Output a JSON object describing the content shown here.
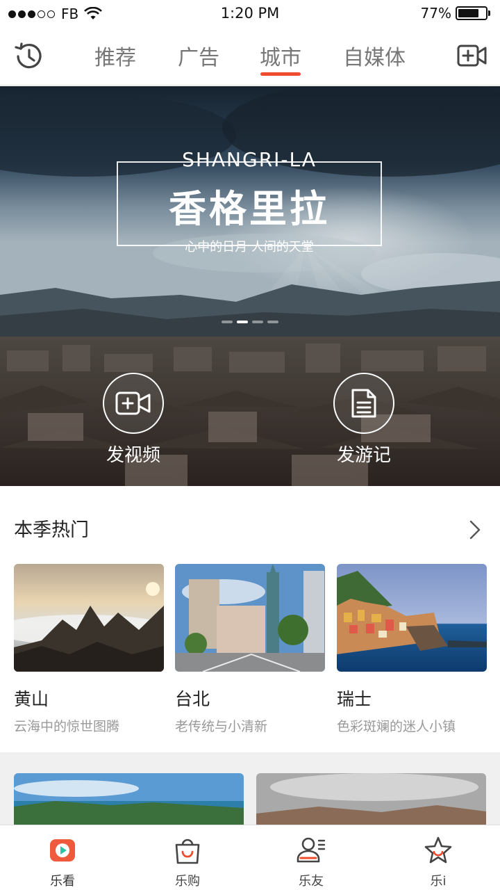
{
  "status_bar": {
    "carrier": "FB",
    "time": "1:20 PM",
    "battery_percent": "77%",
    "battery_level": 0.77
  },
  "top_nav": {
    "tabs": [
      {
        "label": "推荐",
        "active": false
      },
      {
        "label": "广告",
        "active": false
      },
      {
        "label": "城市",
        "active": true
      },
      {
        "label": "自媒体",
        "active": false
      }
    ],
    "accent_color": "#ef4b2f"
  },
  "banner": {
    "title_en": "SHANGRI-LA",
    "title_zh": "香格里拉",
    "subtitle": "心中的日月 人间的天堂",
    "page_count": 4,
    "active_page": 2,
    "actions": [
      {
        "label": "发视频",
        "icon": "video-plus-icon"
      },
      {
        "label": "发游记",
        "icon": "document-icon"
      }
    ]
  },
  "section": {
    "title": "本季热门",
    "cards": [
      {
        "name": "黄山",
        "desc": "云海中的惊世图腾"
      },
      {
        "name": "台北",
        "desc": "老传统与小清新"
      },
      {
        "name": "瑞士",
        "desc": "色彩斑斓的迷人小镇"
      }
    ]
  },
  "bottom_bar": {
    "items": [
      {
        "label": "乐看",
        "icon": "play-icon",
        "active": true
      },
      {
        "label": "乐购",
        "icon": "shopping-bag-icon",
        "active": false
      },
      {
        "label": "乐友",
        "icon": "contacts-icon",
        "active": false
      },
      {
        "label": "乐i",
        "icon": "star-icon",
        "active": false
      }
    ]
  }
}
